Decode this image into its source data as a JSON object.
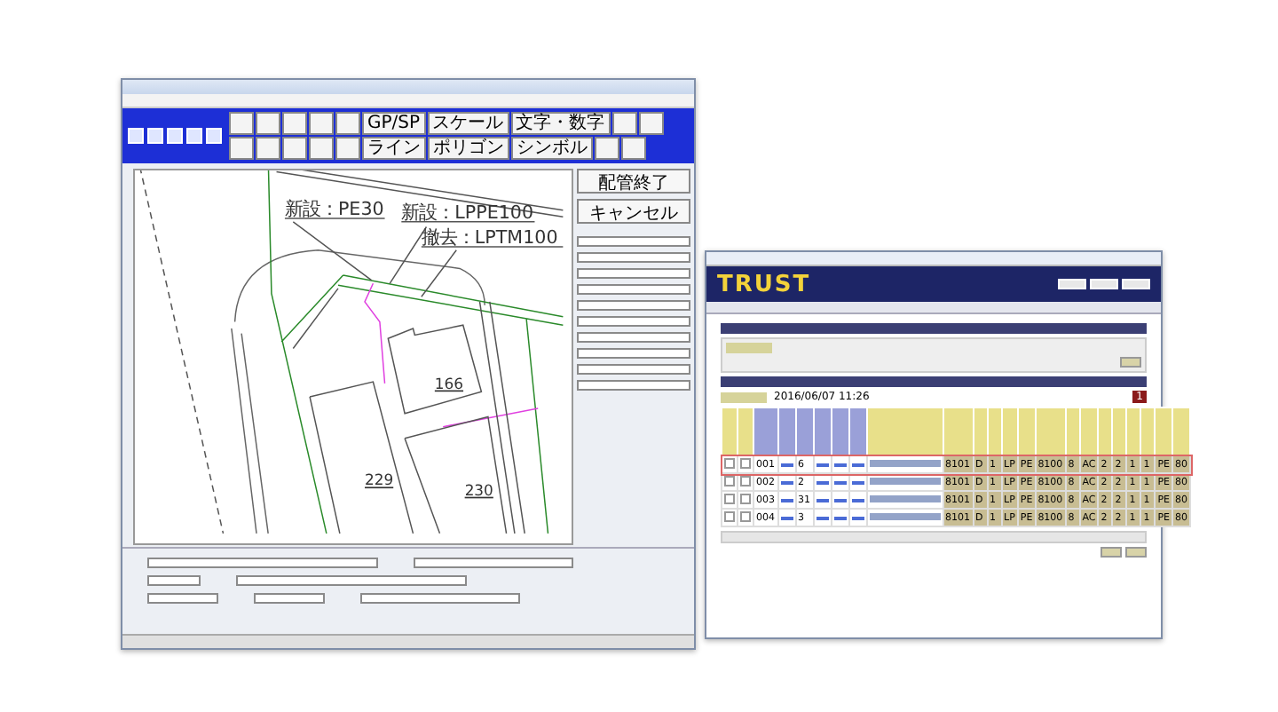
{
  "cad_window": {
    "toolbar": [
      [
        {
          "kind": "blank"
        },
        {
          "kind": "blank"
        },
        {
          "kind": "blank"
        },
        {
          "kind": "blank"
        },
        {
          "kind": "blank"
        },
        {
          "kind": "text",
          "label": "GP/SP"
        },
        {
          "kind": "text",
          "label": "スケール"
        },
        {
          "kind": "text",
          "label": "文字・数字"
        },
        {
          "kind": "blank"
        },
        {
          "kind": "blank"
        }
      ],
      [
        {
          "kind": "blank"
        },
        {
          "kind": "blank"
        },
        {
          "kind": "blank"
        },
        {
          "kind": "blank"
        },
        {
          "kind": "blank"
        },
        {
          "kind": "text",
          "label": "ライン"
        },
        {
          "kind": "text",
          "label": "ポリゴン"
        },
        {
          "kind": "text",
          "label": "シンボル"
        },
        {
          "kind": "blank"
        },
        {
          "kind": "blank"
        }
      ]
    ],
    "drawing": {
      "pipe_labels": [
        "新設：PE30",
        "新設：LPPE100",
        "撤去：LPTM100"
      ],
      "lot_numbers": [
        "166",
        "229",
        "230"
      ]
    },
    "panel_buttons": [
      "配管終了",
      "キャンセル"
    ]
  },
  "browser_window": {
    "logo": "TRUST",
    "date": "2016/06/07 11:26",
    "page": "1",
    "rows": [
      {
        "no": "001",
        "count": "6",
        "selected": true,
        "cells": [
          "8101",
          "D",
          "1",
          "LP",
          "PE",
          "8100",
          "8",
          "AC",
          "2",
          "2",
          "1",
          "1",
          "PE",
          "80"
        ]
      },
      {
        "no": "002",
        "count": "2",
        "selected": false,
        "cells": [
          "8101",
          "D",
          "1",
          "LP",
          "PE",
          "8100",
          "8",
          "AC",
          "2",
          "2",
          "1",
          "1",
          "PE",
          "80"
        ]
      },
      {
        "no": "003",
        "count": "31",
        "selected": false,
        "cells": [
          "8101",
          "D",
          "1",
          "LP",
          "PE",
          "8100",
          "8",
          "AC",
          "2",
          "2",
          "1",
          "1",
          "PE",
          "80"
        ]
      },
      {
        "no": "004",
        "count": "3",
        "selected": false,
        "cells": [
          "8101",
          "D",
          "1",
          "LP",
          "PE",
          "8100",
          "8",
          "AC",
          "2",
          "2",
          "1",
          "1",
          "PE",
          "80"
        ]
      }
    ]
  }
}
